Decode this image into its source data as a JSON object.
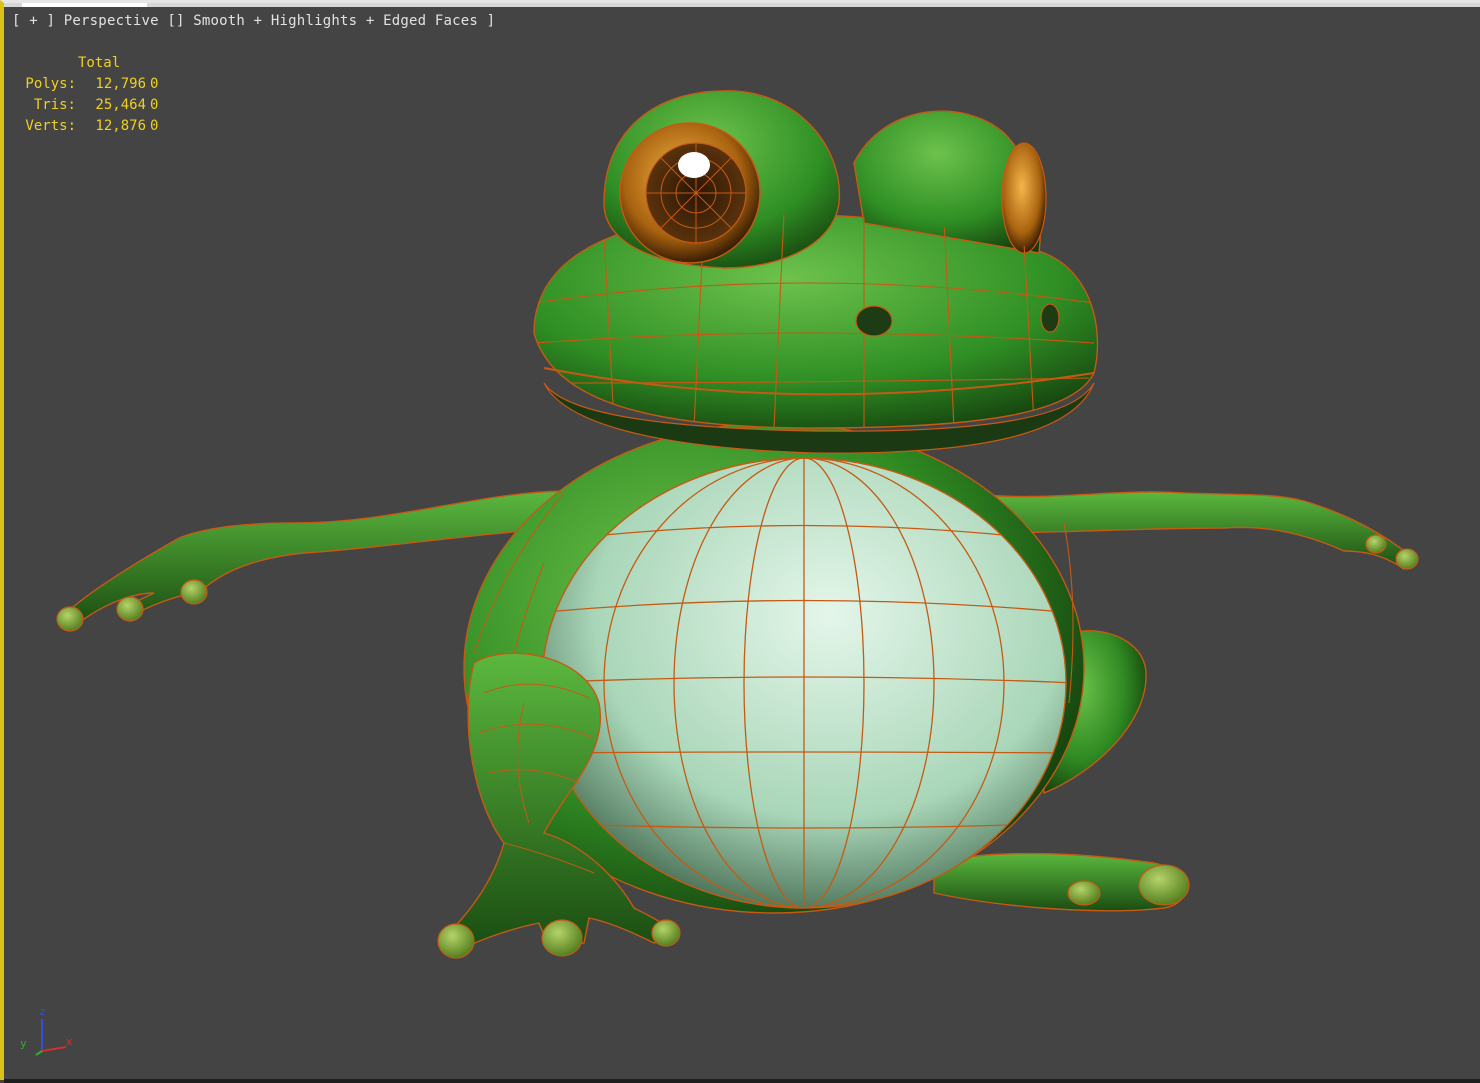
{
  "viewport": {
    "label_parts": [
      "[ + ]",
      "Perspective",
      "[]",
      "Smooth + Highlights + Edged Faces ]"
    ],
    "background_color": "#444444",
    "active_border_color": "#d9c21a",
    "wireframe_color": "#c55a14"
  },
  "stats": {
    "header": "Total",
    "rows": [
      {
        "label": "Polys:",
        "total": "12,796",
        "selected": "0"
      },
      {
        "label": "Tris:",
        "total": "25,464",
        "selected": "0"
      },
      {
        "label": "Verts:",
        "total": "12,876",
        "selected": "0"
      }
    ],
    "text_color": "#f0d020"
  },
  "axis_gizmo": {
    "labels": [
      "z",
      "y",
      "x"
    ],
    "colors": {
      "x": "#d03030",
      "y": "#30b030",
      "z": "#3050e0"
    }
  },
  "model": {
    "subject": "frog",
    "skin_color": "#3a9a2a",
    "belly_color": "#cfe8d8",
    "eye_color": "#c77a18"
  }
}
